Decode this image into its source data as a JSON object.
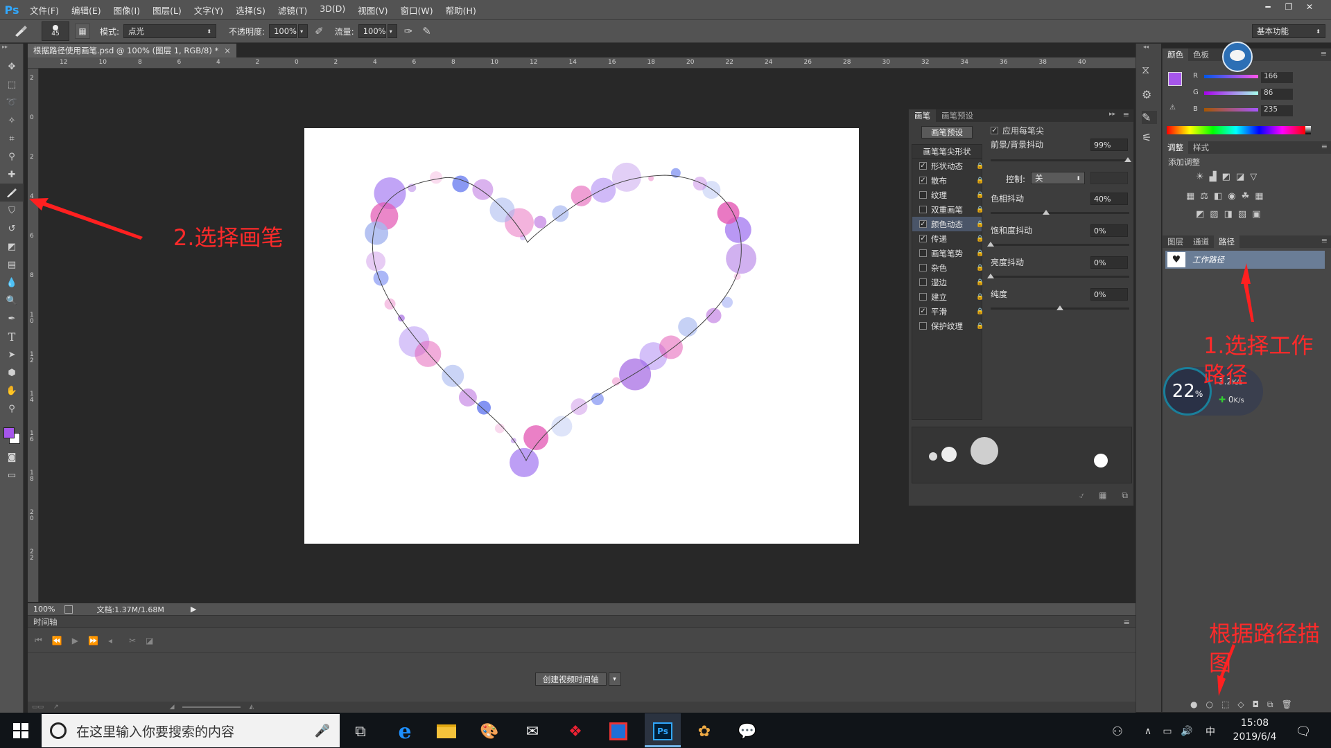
{
  "app": {
    "logo": "Ps"
  },
  "menu": [
    "文件(F)",
    "编辑(E)",
    "图像(I)",
    "图层(L)",
    "文字(Y)",
    "选择(S)",
    "滤镜(T)",
    "3D(D)",
    "视图(V)",
    "窗口(W)",
    "帮助(H)"
  ],
  "options": {
    "brush_size": "45",
    "mode_label": "模式:",
    "mode_value": "点光",
    "opacity_label": "不透明度:",
    "opacity_value": "100%",
    "flow_label": "流量:",
    "flow_value": "100%",
    "workspace": "基本功能"
  },
  "document": {
    "tab_title": "根据路径使用画笔.psd @ 100% (图层 1, RGB/8) *",
    "zoom": "100%",
    "doc_size": "文档:1.37M/1.68M"
  },
  "ruler_h": [
    "12",
    "10",
    "8",
    "6",
    "4",
    "2",
    "0",
    "2",
    "4",
    "6",
    "8",
    "10",
    "12",
    "14",
    "16",
    "18",
    "20",
    "22",
    "24",
    "26",
    "28",
    "30",
    "32",
    "34",
    "36",
    "38",
    "40"
  ],
  "ruler_v": [
    "2",
    "0",
    "2",
    "4",
    "6",
    "8",
    "10",
    "12",
    "14",
    "16",
    "18",
    "20",
    "22"
  ],
  "timeline": {
    "title": "时间轴",
    "create_button": "创建视频时间轴"
  },
  "brush_panel": {
    "tabs": [
      "画笔",
      "画笔预设"
    ],
    "preset_button": "画笔预设",
    "tip_shape": "画笔笔尖形状",
    "options": [
      {
        "label": "形状动态",
        "checked": true
      },
      {
        "label": "散布",
        "checked": true
      },
      {
        "label": "纹理",
        "checked": false
      },
      {
        "label": "双重画笔",
        "checked": false
      },
      {
        "label": "颜色动态",
        "checked": true
      },
      {
        "label": "传递",
        "checked": true
      },
      {
        "label": "画笔笔势",
        "checked": false
      },
      {
        "label": "杂色",
        "checked": false
      },
      {
        "label": "湿边",
        "checked": false
      },
      {
        "label": "建立",
        "checked": false
      },
      {
        "label": "平滑",
        "checked": true
      },
      {
        "label": "保护纹理",
        "checked": false
      }
    ],
    "apply_per_tip": "应用每笔尖",
    "fg_bg_jitter_label": "前景/背景抖动",
    "fg_bg_jitter_value": "99%",
    "control_label": "控制:",
    "control_value": "关",
    "hue_jitter_label": "色相抖动",
    "hue_jitter_value": "40%",
    "saturation_jitter_label": "饱和度抖动",
    "saturation_jitter_value": "0%",
    "brightness_jitter_label": "亮度抖动",
    "brightness_jitter_value": "0%",
    "purity_label": "纯度",
    "purity_value": "0%"
  },
  "color_panel": {
    "tabs": [
      "颜色",
      "色板"
    ],
    "r_label": "R",
    "r_value": "166",
    "g_label": "G",
    "g_value": "86",
    "b_label": "B",
    "b_value": "235",
    "fg_color": "#a656eb"
  },
  "adjust_panel": {
    "tabs": [
      "调整",
      "样式"
    ],
    "add_label": "添加调整"
  },
  "paths_panel": {
    "tabs": [
      "图层",
      "通道",
      "路径"
    ],
    "item": "工作路径"
  },
  "net_widget": {
    "percent": "22",
    "pct_sign": "%",
    "up": "3.2",
    "down": "0",
    "unit": "K/s"
  },
  "annotations": {
    "select_brush": "2.选择画笔",
    "select_path": "1.选择工作路径",
    "stroke_path": "根据路径描图"
  },
  "taskbar": {
    "search_placeholder": "在这里输入你要搜索的内容",
    "ime": "中",
    "time": "15:08",
    "date": "2019/6/4"
  }
}
